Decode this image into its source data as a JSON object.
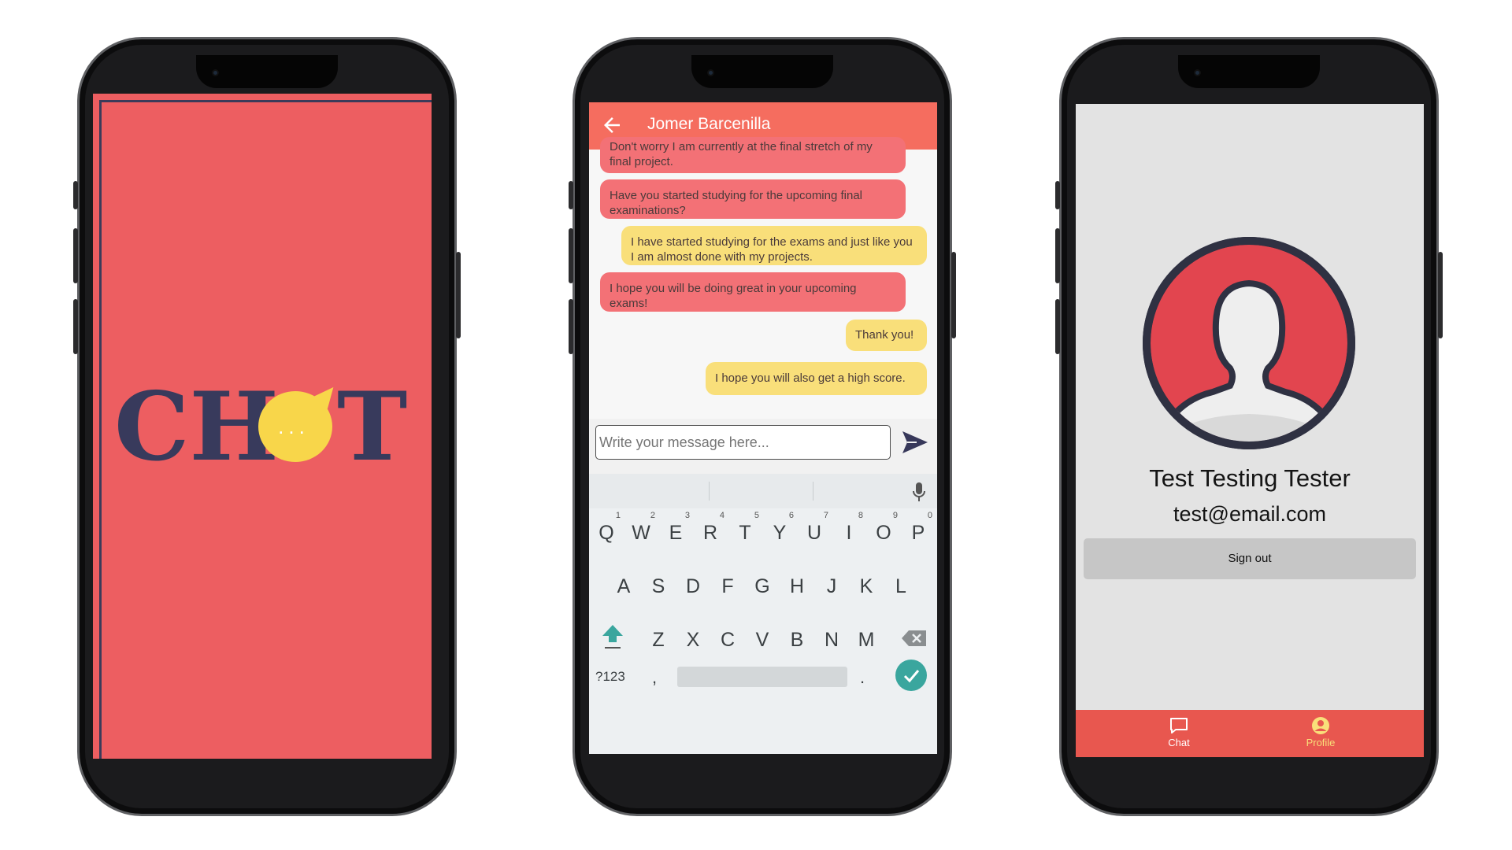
{
  "splash": {
    "logo_text_left": "CH",
    "logo_text_right": "T",
    "logo_bubble_dots": "...",
    "colors": {
      "background": "#ed5e61",
      "logo_text": "#383a5c",
      "bubble": "#f8d64a"
    }
  },
  "chat": {
    "header": {
      "title": "Jomer Barcenilla",
      "back_icon": "arrow-left-icon"
    },
    "messages": [
      {
        "direction": "incoming",
        "text": "Don't worry I am currently at the final stretch of my final project."
      },
      {
        "direction": "incoming",
        "text": "Have you started studying for the upcoming final examinations?"
      },
      {
        "direction": "outgoing",
        "text": "I have started studying for the exams and just like you I am almost done with my projects."
      },
      {
        "direction": "incoming",
        "text": "I hope you will be doing great in your upcoming exams!"
      },
      {
        "direction": "outgoing",
        "text": "Thank you!"
      },
      {
        "direction": "outgoing",
        "text": "I hope you will also get a high score."
      }
    ],
    "composer": {
      "placeholder": "Write your message here...",
      "send_icon": "send-icon"
    },
    "keyboard": {
      "row1": [
        "Q",
        "W",
        "E",
        "R",
        "T",
        "Y",
        "U",
        "I",
        "O",
        "P"
      ],
      "row1_numbers": [
        "1",
        "2",
        "3",
        "4",
        "5",
        "6",
        "7",
        "8",
        "9",
        "0"
      ],
      "row2": [
        "A",
        "S",
        "D",
        "F",
        "G",
        "H",
        "J",
        "K",
        "L"
      ],
      "row3": [
        "Z",
        "X",
        "C",
        "V",
        "B",
        "N",
        "M"
      ],
      "symbols_key": "?123",
      "comma_key": ",",
      "period_key": "."
    },
    "colors": {
      "header": "#f56d5f",
      "incoming": "#f37176",
      "outgoing": "#f9df7a",
      "enter": "#3aa69e"
    }
  },
  "profile": {
    "name": "Test Testing Tester",
    "email": "test@email.com",
    "sign_out_label": "Sign out",
    "nav": [
      {
        "label": "Chat",
        "icon": "chat-icon",
        "active": false
      },
      {
        "label": "Profile",
        "icon": "account-circle-icon",
        "active": true
      }
    ],
    "colors": {
      "nav_bg": "#e8574f",
      "nav_active": "#f9df7a",
      "avatar_ring": "#e2454f"
    }
  }
}
